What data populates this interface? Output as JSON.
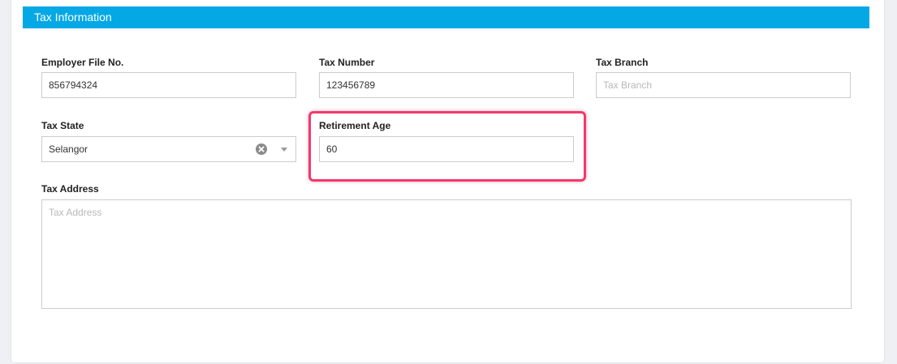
{
  "section": {
    "title": "Tax Information"
  },
  "fields": {
    "employer_file_no": {
      "label": "Employer File No.",
      "value": "856794324",
      "placeholder": ""
    },
    "tax_number": {
      "label": "Tax Number",
      "value": "123456789",
      "placeholder": ""
    },
    "tax_branch": {
      "label": "Tax Branch",
      "value": "",
      "placeholder": "Tax Branch"
    },
    "tax_state": {
      "label": "Tax State",
      "value": "Selangor"
    },
    "retirement_age": {
      "label": "Retirement Age",
      "value": "60",
      "placeholder": ""
    },
    "tax_address": {
      "label": "Tax Address",
      "value": "",
      "placeholder": "Tax Address"
    }
  },
  "icons": {
    "clear": "clear-icon",
    "dropdown": "chevron-down-icon"
  },
  "colors": {
    "header_bg": "#03a8e5",
    "highlight": "#f03a6c"
  }
}
